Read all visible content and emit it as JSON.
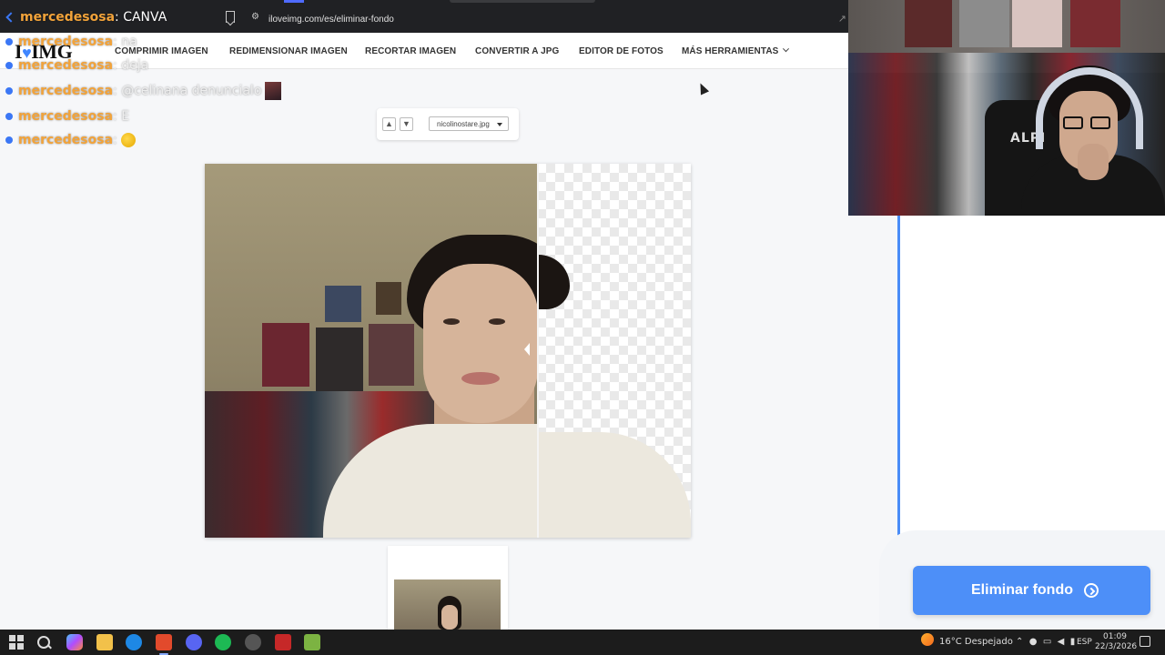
{
  "browser": {
    "url": "iloveimg.com/es/eliminar-fondo"
  },
  "site": {
    "logo_text": "I",
    "logo_text2": "IMG",
    "nav": [
      {
        "label": "COMPRIMIR IMAGEN"
      },
      {
        "label": "REDIMENSIONAR IMAGEN"
      },
      {
        "label": "RECORTAR IMAGEN"
      },
      {
        "label": "CONVERTIR A JPG"
      },
      {
        "label": "EDITOR DE FOTOS"
      },
      {
        "label": "MÁS HERRAMIENTAS"
      }
    ]
  },
  "chat": {
    "header": {
      "user": "mercedesosa",
      "msg": ": CANVA"
    },
    "lines": [
      {
        "user": "mercedesosa",
        "msg": ": na"
      },
      {
        "user": "mercedesosa",
        "msg": ": deja"
      },
      {
        "user": "mercedesosa",
        "msg": ": @celinana denuncialo"
      },
      {
        "user": "mercedesosa",
        "msg": ": E"
      },
      {
        "user": "mercedesosa",
        "msg": ": "
      }
    ]
  },
  "editor": {
    "file_select": "nicolinostare.jpg",
    "up_arrow": "▲",
    "down_arrow": "▼"
  },
  "cta": {
    "label": "Eliminar fondo"
  },
  "webcam": {
    "chair_label": "ALPI"
  },
  "taskbar": {
    "weather": "16°C  Despejado",
    "language": "ESP",
    "time": "01:09",
    "date": "22/3/2026"
  },
  "colors": {
    "accent": "#4d8ff8",
    "chat_user": "#f2a33a",
    "taskbar": "#1c1c1c"
  }
}
